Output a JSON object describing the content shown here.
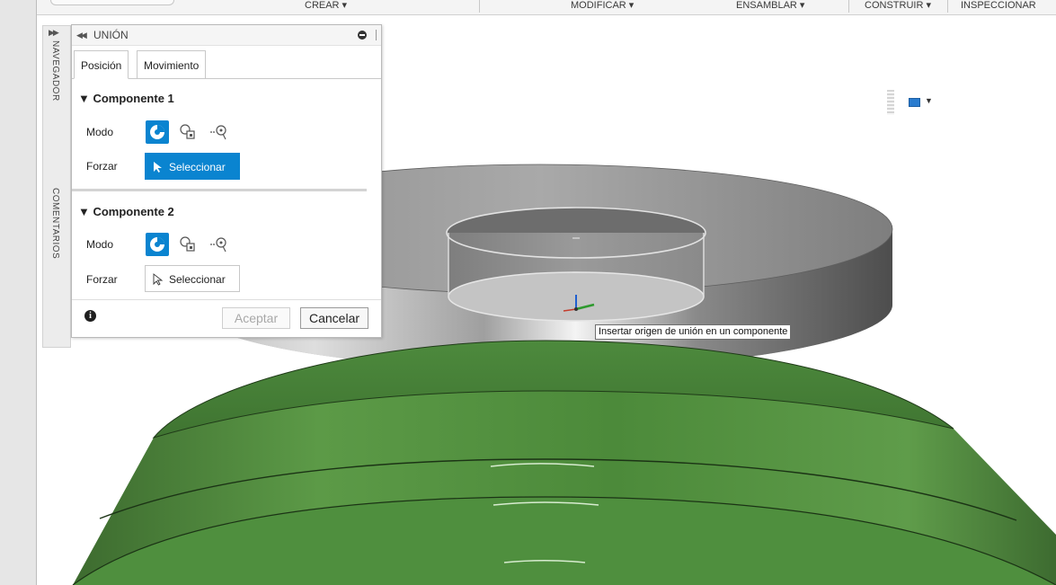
{
  "toolbar": {
    "menus": [
      {
        "label": "CREAR ▾"
      },
      {
        "label": "MODIFICAR ▾"
      },
      {
        "label": "ENSAMBLAR ▾"
      },
      {
        "label": "CONSTRUIR ▾"
      },
      {
        "label": "INSPECCIONAR"
      }
    ]
  },
  "side_strip": {
    "navigator_label": "NAVEGADOR",
    "comments_label": "COMENTARIOS"
  },
  "panel": {
    "title": "UNIÓN",
    "tabs": [
      {
        "label": "Posición",
        "active": true
      },
      {
        "label": "Movimiento",
        "active": false
      }
    ],
    "component1": {
      "title": "▼ Componente 1",
      "mode_label": "Modo",
      "force_label": "Forzar",
      "select_label": "Seleccionar",
      "select_state": "active"
    },
    "component2": {
      "title": "▼ Componente 2",
      "mode_label": "Modo",
      "force_label": "Forzar",
      "select_label": "Seleccionar",
      "select_state": "idle"
    },
    "accept_label": "Aceptar",
    "cancel_label": "Cancelar",
    "info_glyph": "i"
  },
  "tooltip": {
    "text": "Insertar origen de unión en un componente"
  },
  "icons": {
    "collapse": "double-chevron-left-icon",
    "expand": "double-chevron-right-icon",
    "minimize": "minimize-icon",
    "display_settings": "display-settings-icon"
  },
  "colors": {
    "accent": "#0a84d0",
    "model_green": "#4e8a3c",
    "model_gray": "#a8a8a8"
  }
}
